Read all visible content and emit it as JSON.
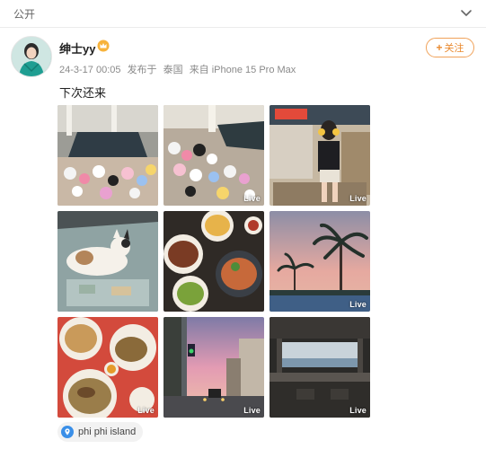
{
  "header": {
    "visibility": "公开"
  },
  "post": {
    "author": "绅士yy",
    "timestamp": "24-3-17 00:05",
    "posted_from_label": "发布于",
    "region": "泰国",
    "source": "来自 iPhone 15 Pro Max",
    "follow_label": "关注",
    "text": "下次还来",
    "live_label": "Live",
    "location": "phi phi island"
  },
  "colors": {
    "accent": "#f0a25a",
    "location_pin": "#3a8fe8"
  }
}
